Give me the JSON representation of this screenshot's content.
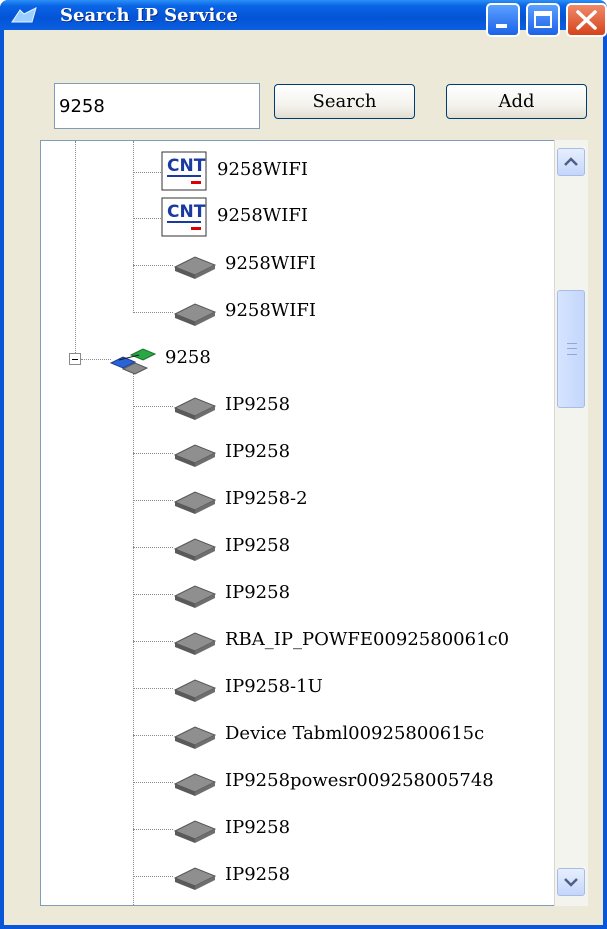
{
  "window": {
    "title": "Search IP Service",
    "controls": [
      "minimize-icon",
      "maximize-icon",
      "close-icon"
    ]
  },
  "toolbar": {
    "search_value": "9258",
    "search_label": "Search",
    "add_label": "Add"
  },
  "tree": {
    "group_a_items": [
      {
        "label": "9258WIFI",
        "icon": "cnt-logo-icon"
      },
      {
        "label": "9258WIFI",
        "icon": "cnt-logo-icon"
      },
      {
        "label": "9258WIFI",
        "icon": "ip-camera-icon"
      },
      {
        "label": "9258WIFI",
        "icon": "ip-camera-icon"
      }
    ],
    "group_b": {
      "label": "9258",
      "icon": "network-group-icon",
      "expanded": true,
      "items": [
        {
          "label": "IP9258",
          "icon": "ip-camera-icon"
        },
        {
          "label": "IP9258",
          "icon": "ip-camera-icon"
        },
        {
          "label": "IP9258-2",
          "icon": "ip-camera-icon"
        },
        {
          "label": "IP9258",
          "icon": "ip-camera-icon"
        },
        {
          "label": "IP9258",
          "icon": "ip-camera-icon"
        },
        {
          "label": "RBA_IP_POWFE0092580061c0",
          "icon": "ip-camera-icon"
        },
        {
          "label": "IP9258-1U",
          "icon": "ip-camera-icon"
        },
        {
          "label": "Device Tabml00925800615c",
          "icon": "ip-camera-icon"
        },
        {
          "label": "IP9258powesr009258005748",
          "icon": "ip-camera-icon"
        },
        {
          "label": "IP9258",
          "icon": "ip-camera-icon"
        },
        {
          "label": "IP9258",
          "icon": "ip-camera-icon"
        }
      ]
    }
  },
  "colors": {
    "titlebar": "#0453d6",
    "window_bg": "#ece9d8",
    "close_button": "#d5431b"
  }
}
